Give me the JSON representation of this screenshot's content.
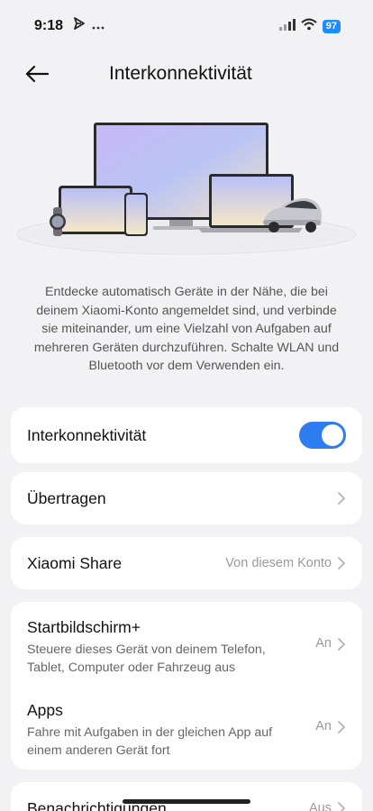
{
  "status_bar": {
    "time": "9:18",
    "left_icons": [
      "send-icon",
      "more-dots-icon"
    ],
    "right_icons": [
      "signal-icon",
      "wifi-icon"
    ],
    "battery": "97"
  },
  "header": {
    "title": "Interkonnektivität",
    "back_icon": "back-arrow-icon"
  },
  "illustration": {
    "devices": [
      "monitor",
      "tablet",
      "smartwatch",
      "phone",
      "laptop",
      "car"
    ]
  },
  "description": "Entdecke automatisch Geräte in der Nähe, die bei deinem Xiaomi-Konto angemeldet sind, und verbinde sie miteinander, um eine Vielzahl von Aufgaben auf mehreren Geräten durchzuführen. Schalte WLAN und Bluetooth vor dem Verwenden ein.",
  "settings": {
    "interconnectivity": {
      "label": "Interkonnektivität",
      "enabled": true
    },
    "transfer": {
      "label": "Übertragen"
    },
    "xiaomi_share": {
      "label": "Xiaomi Share",
      "value": "Von diesem Konto"
    },
    "home_screen": {
      "label": "Startbildschirm+",
      "description": "Steuere dieses Gerät von deinem Telefon, Tablet, Computer oder Fahrzeug aus",
      "value": "An"
    },
    "apps": {
      "label": "Apps",
      "description": "Fahre mit Aufgaben in der gleichen App auf einem anderen Gerät fort",
      "value": "An"
    },
    "notifications": {
      "label": "Benachrichtigungen",
      "value": "Aus"
    }
  },
  "colors": {
    "accent": "#2d7cf0",
    "background": "#f2f2f4",
    "card": "#ffffff"
  }
}
